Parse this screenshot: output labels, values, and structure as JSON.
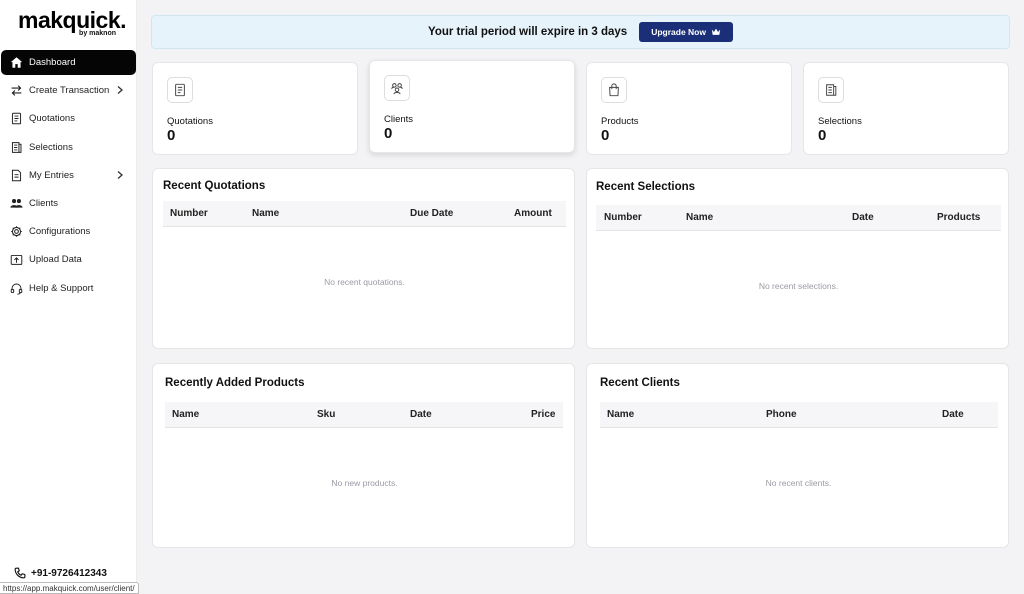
{
  "brand": {
    "name": "makquick.",
    "sub": "by maknon"
  },
  "sidebar": {
    "items": [
      {
        "label": "Dashboard",
        "icon": "home-icon",
        "active": true
      },
      {
        "label": "Create Transaction",
        "icon": "arrows-swap-icon",
        "chevron": true
      },
      {
        "label": "Quotations",
        "icon": "document-icon"
      },
      {
        "label": "Selections",
        "icon": "list-icon"
      },
      {
        "label": "My Entries",
        "icon": "file-icon",
        "chevron": true
      },
      {
        "label": "Clients",
        "icon": "users-icon"
      },
      {
        "label": "Configurations",
        "icon": "gear-icon"
      },
      {
        "label": "Upload Data",
        "icon": "upload-icon"
      },
      {
        "label": "Help & Support",
        "icon": "headset-icon"
      }
    ],
    "phone": "+91-9726412343"
  },
  "statusbar": {
    "url": "https://app.makquick.com/user/client/"
  },
  "banner": {
    "text": "Your trial period will expire in 3 days",
    "button": "Upgrade Now"
  },
  "stats": [
    {
      "label": "Quotations",
      "value": "0",
      "icon": "quotation-icon"
    },
    {
      "label": "Clients",
      "value": "0",
      "icon": "clients-icon"
    },
    {
      "label": "Products",
      "value": "0",
      "icon": "bag-icon"
    },
    {
      "label": "Selections",
      "value": "0",
      "icon": "selection-icon"
    }
  ],
  "panels": {
    "quotations": {
      "title": "Recent Quotations",
      "columns": [
        "Number",
        "Name",
        "Due Date",
        "Amount"
      ],
      "empty": "No recent quotations."
    },
    "selections": {
      "title": "Recent Selections",
      "columns": [
        "Number",
        "Name",
        "Date",
        "Products"
      ],
      "empty": "No recent selections."
    },
    "products": {
      "title": "Recently Added Products",
      "columns": [
        "Name",
        "Sku",
        "Date",
        "Price"
      ],
      "empty": "No new products."
    },
    "clients": {
      "title": "Recent Clients",
      "columns": [
        "Name",
        "Phone",
        "Date"
      ],
      "empty": "No recent clients."
    }
  },
  "colors": {
    "accent": "#1b2f79",
    "banner_bg": "#e6f3fb",
    "active_nav": "#050505"
  }
}
